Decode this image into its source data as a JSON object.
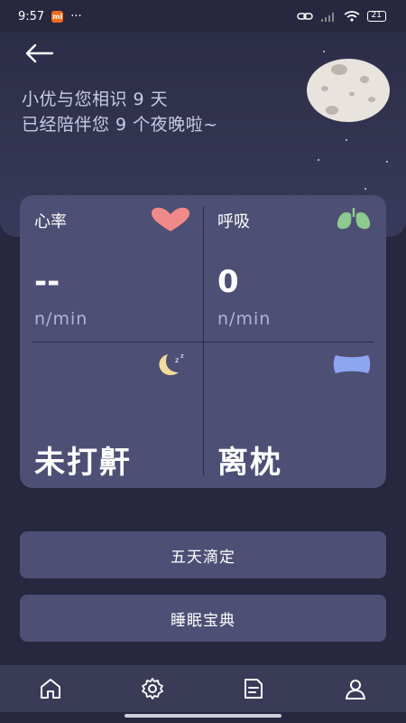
{
  "status_bar": {
    "time": "9:57",
    "app_badge": "mi",
    "more": "···",
    "battery": "21"
  },
  "intro": {
    "line1": "小优与您相识 9 天",
    "line2": "已经陪伴您 9 个夜晚啦~"
  },
  "metrics": {
    "heart_rate": {
      "label": "心率",
      "value": "--",
      "unit": "n/min"
    },
    "breathing": {
      "label": "呼吸",
      "value": "0",
      "unit": "n/min"
    },
    "snoring": {
      "value": "未打鼾"
    },
    "pillow": {
      "value": "离枕"
    }
  },
  "buttons": {
    "five_day": "五天滴定",
    "sleep_guide": "睡眠宝典"
  },
  "bottom_nav": {
    "tabs": [
      "home-icon",
      "settings-icon",
      "report-icon",
      "profile-icon"
    ]
  },
  "colors": {
    "background": "#27283f",
    "card": "#4e4f75",
    "heart": "#f08a8a",
    "lungs": "#8ec98f",
    "pillow": "#8ea6f2"
  }
}
